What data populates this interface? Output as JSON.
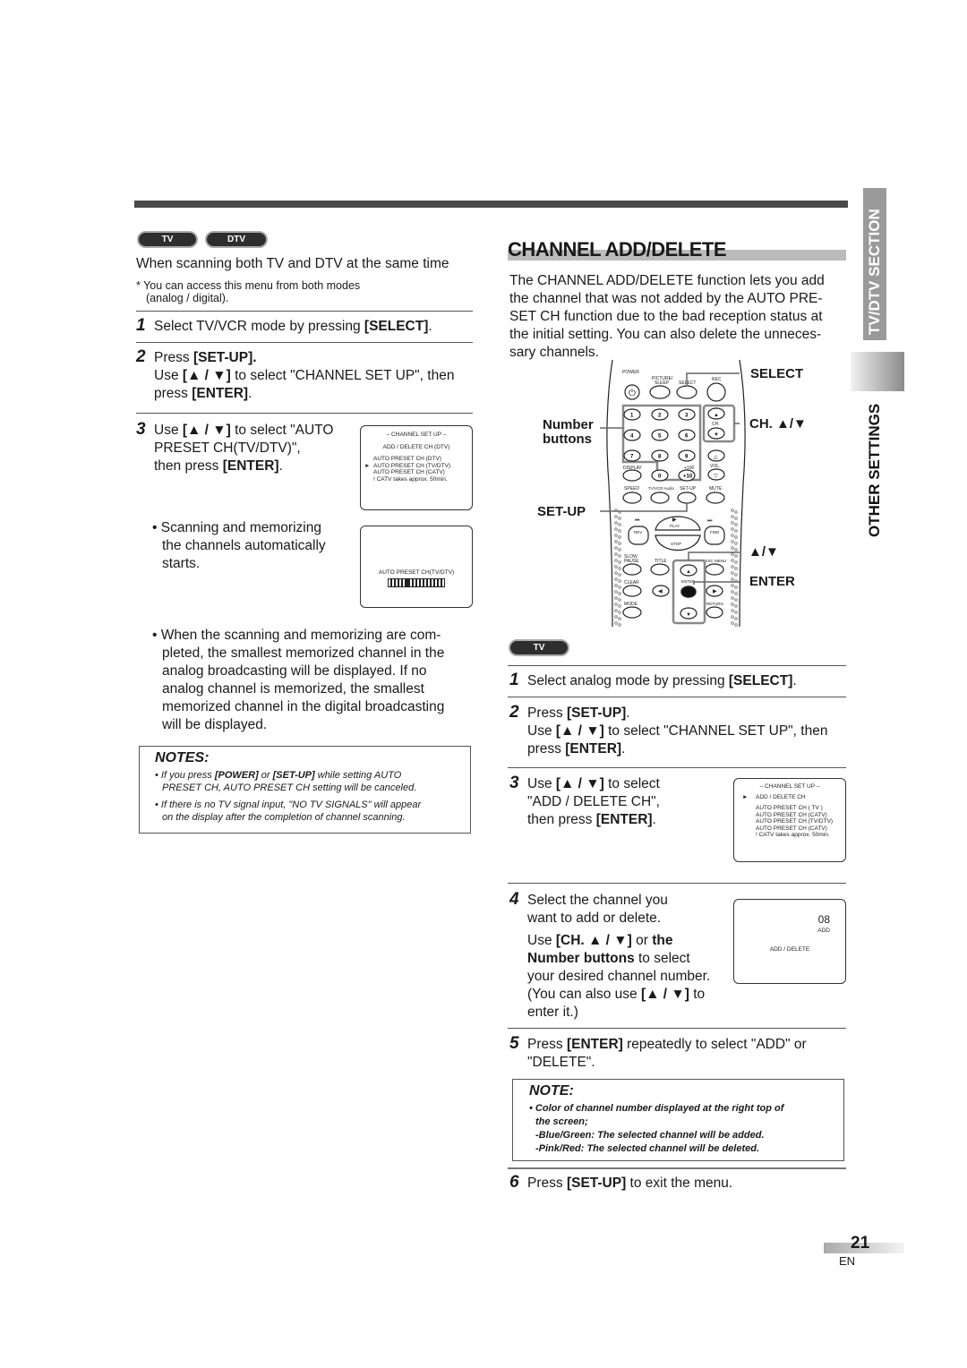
{
  "left": {
    "mode_badges": [
      "TV",
      "DTV"
    ],
    "heading": "When scanning both TV and DTV at the same time",
    "access_note": "* You can access this menu from both modes",
    "access_note_2": "(analog / digital).",
    "steps": [
      {
        "num": "1",
        "pre": "Select TV/VCR mode by pressing ",
        "bold": "[SELECT]",
        "post": "."
      },
      {
        "num": "2",
        "line1_pre": "Press ",
        "line1_bold": "[SET-UP].",
        "line2_pre": "Use ",
        "line2_bold": "[▲ / ▼]",
        "line2_post": " to select \"CHANNEL SET UP\", then",
        "line3_pre": "press ",
        "line3_bold": "[ENTER]",
        "line3_post": "."
      },
      {
        "num": "3",
        "line1_pre": "Use ",
        "line1_bold": "[▲ / ▼]",
        "line1_post": " to select \"AUTO",
        "line2": "PRESET CH(TV/DTV)\",",
        "line3_pre": "then press ",
        "line3_bold": "[ENTER]",
        "line3_post": "."
      }
    ],
    "screen1": {
      "title": "– CHANNEL SET UP –",
      "item0": "ADD / DELETE CH (DTV)",
      "items": [
        "AUTO PRESET CH (DTV)",
        "AUTO PRESET CH (TV/DTV)",
        "AUTO PRESET CH (CATV)",
        "! CATV takes approx. 50min."
      ],
      "selected_index": 1,
      "cursor": "►"
    },
    "bullet1": [
      "• Scanning and memorizing",
      "the channels automatically",
      "starts."
    ],
    "screen2": {
      "label": "AUTO PRESET CH(TV/DTV)",
      "progress_segments": 16,
      "progress_active_index": 5
    },
    "bullet2": [
      "• When the scanning and memorizing are com-",
      "pleted, the smallest memorized channel in the",
      "analog broadcasting will be displayed. If no",
      "analog channel is memorized, the smallest",
      "memorized channel in the digital broadcasting",
      "will be displayed."
    ],
    "notes": {
      "title": "NOTES:",
      "items": [
        {
          "pre": "• If you press ",
          "b1": "[POWER]",
          "mid": " or ",
          "b2": "[SET-UP]",
          "post": " while setting AUTO",
          "line2": "PRESET CH, AUTO PRESET CH setting will be canceled."
        },
        {
          "line1": "• If there is no TV signal input, \"NO TV SIGNALS\" will appear",
          "line2": "on the display after the completion of channel scanning."
        }
      ]
    }
  },
  "right": {
    "title": "CHANNEL ADD/DELETE",
    "intro": [
      "The CHANNEL ADD/DELETE function lets you add",
      "the channel that was not added by the AUTO PRE-",
      "SET CH function due to the bad reception status at",
      "the initial setting. You can also delete the unneces-",
      "sary channels."
    ],
    "remote": {
      "callouts": {
        "select": "SELECT",
        "ch": "CH. ▲/▼",
        "number": "Number",
        "buttons": "buttons",
        "setup": "SET-UP",
        "arrows": "▲/▼",
        "enter": "ENTER"
      },
      "labels": {
        "power": "POWER",
        "picture": "PICTURE/",
        "sleep": "SLEEP",
        "select": "SELECT",
        "rec": "REC",
        "ch": "CH.",
        "vol": "VOL.",
        "display": "DISPLAY",
        "plus100": "+100",
        "plus10": "+10",
        "speed": "SPEED",
        "tvvcr": "TV/VCR Audio",
        "setup": "SET-UP",
        "mute": "MUTE",
        "play": "PLAY",
        "rev": "REV",
        "fwd": "FWD",
        "stop": "STOP",
        "slow": "SLOW",
        "pause": "PAUSE",
        "title": "TITLE",
        "discmenu": "DISC MENU",
        "clear": "CLEAR",
        "enter": "ENTER",
        "mode": "MODE",
        "return": "RETURN"
      },
      "digits": [
        "1",
        "2",
        "3",
        "4",
        "5",
        "6",
        "7",
        "8",
        "9",
        "0"
      ]
    },
    "mode_badge": "TV",
    "steps": {
      "s1": {
        "num": "1",
        "pre": "Select analog mode by pressing ",
        "bold": "[SELECT]",
        "post": "."
      },
      "s2": {
        "num": "2",
        "l1_pre": "Press ",
        "l1_bold": "[SET-UP]",
        "l1_post": ".",
        "l2_pre": "Use ",
        "l2_bold": "[▲ / ▼]",
        "l2_post": " to select \"CHANNEL SET UP\", then",
        "l3_pre": "press  ",
        "l3_bold": "[ENTER]",
        "l3_post": "."
      },
      "s3": {
        "num": "3",
        "l1_pre": "Use ",
        "l1_bold": "[▲ / ▼]",
        "l1_post": " to select",
        "l2": "\"ADD / DELETE CH\",",
        "l3_pre": "then press ",
        "l3_bold": "[ENTER]",
        "l3_post": "."
      },
      "s4": {
        "num": "4",
        "l1": "Select the channel you",
        "l2": "want to add or delete.",
        "l3_pre": "Use ",
        "l3_bold": "[CH. ▲ / ▼]",
        "l3_mid": " or ",
        "l3_bold2": "the",
        "l4_bold": "Number buttons",
        "l4_post": " to select",
        "l5": "your desired channel number.",
        "l6_pre": "(You can also use ",
        "l6_bold": "[▲ / ▼]",
        "l6_post": " to",
        "l7": "enter it.)"
      },
      "s5": {
        "num": "5",
        "l1_pre": "Press ",
        "l1_bold": "[ENTER]",
        "l1_post": " repeatedly to select \"ADD\" or",
        "l2": "\"DELETE\"."
      },
      "s6": {
        "num": "6",
        "pre": "Press ",
        "bold": "[SET-UP]",
        "post": " to exit the menu."
      }
    },
    "screen3": {
      "title": "– CHANNEL SET UP –",
      "cursor": "►",
      "item0": "ADD / DELETE CH",
      "items": [
        "AUTO PRESET CH (  TV  )",
        "AUTO PRESET CH (CATV)",
        "AUTO PRESET CH (TV/DTV)",
        "AUTO PRESET CH (CATV)",
        "! CATV takes approx. 50min."
      ]
    },
    "screen4": {
      "channel": "08",
      "status": "ADD",
      "label": "ADD / DELETE"
    },
    "note": {
      "title": "NOTE:",
      "lines": [
        "• Color of channel number displayed at the right top of",
        "the screen;",
        "-Blue/Green: The selected channel will be added.",
        "-Pink/Red: The selected channel will be deleted."
      ]
    }
  },
  "side_tabs": {
    "section": "TV/DTV SECTION",
    "category": "OTHER SETTINGS"
  },
  "footer": {
    "page_number": "21",
    "language": "EN"
  }
}
